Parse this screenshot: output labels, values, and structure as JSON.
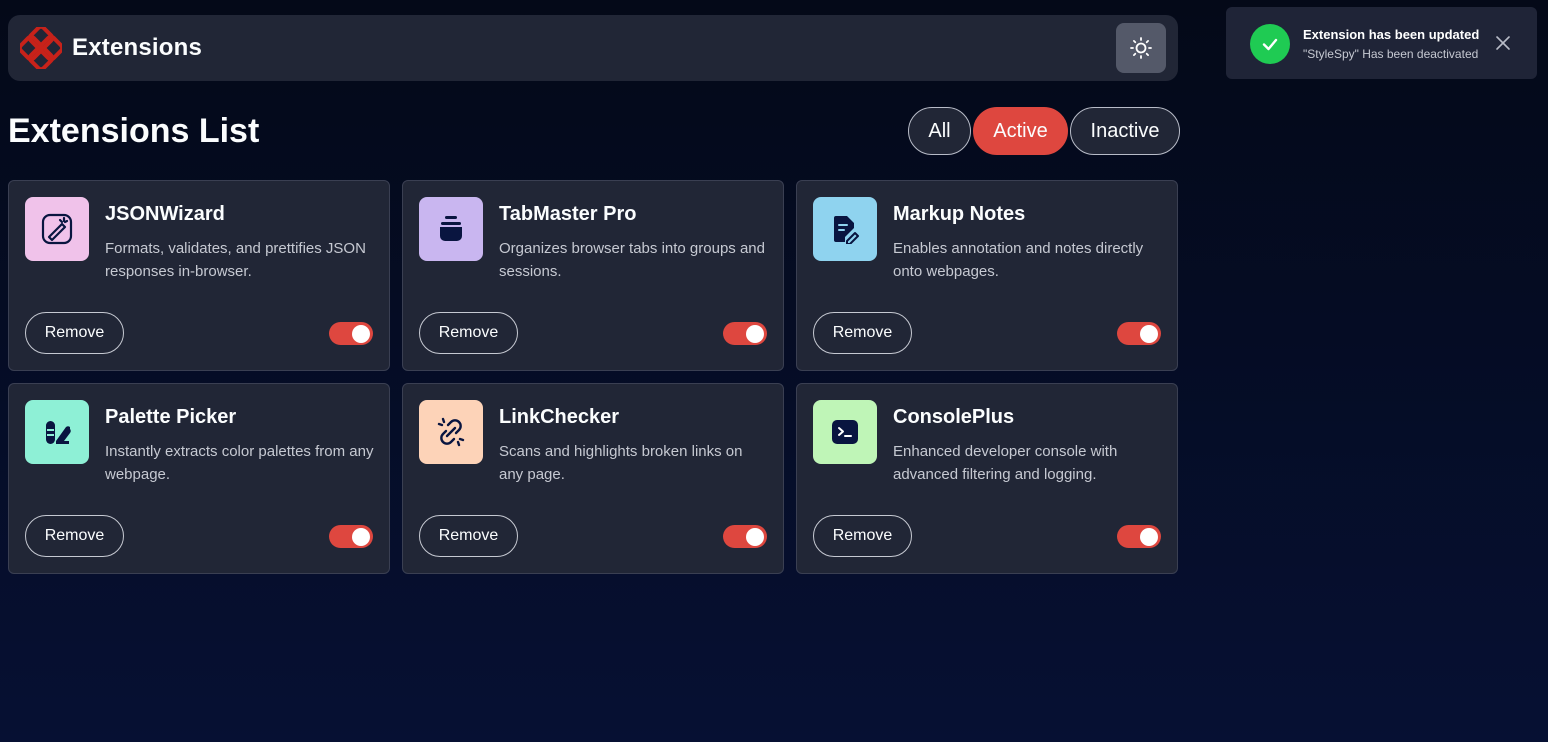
{
  "header": {
    "app_title": "Extensions",
    "logo_icon": "extensions-logo-icon",
    "theme_toggle_icon": "sun-icon"
  },
  "list": {
    "title": "Extensions List",
    "filters": [
      {
        "label": "All",
        "selected": false
      },
      {
        "label": "Active",
        "selected": true
      },
      {
        "label": "Inactive",
        "selected": false
      }
    ]
  },
  "extensions": [
    {
      "name": "JSONWizard",
      "description": "Formats, validates, and prettifies JSON responses in-browser.",
      "remove_label": "Remove",
      "active": true,
      "icon": "json-wizard-icon",
      "icon_bg": "#f0c2ea"
    },
    {
      "name": "TabMaster Pro",
      "description": "Organizes browser tabs into groups and sessions.",
      "remove_label": "Remove",
      "active": true,
      "icon": "tab-master-icon",
      "icon_bg": "#c9b6f0"
    },
    {
      "name": "Markup Notes",
      "description": "Enables annotation and notes directly onto webpages.",
      "remove_label": "Remove",
      "active": true,
      "icon": "markup-notes-icon",
      "icon_bg": "#8fd3ef"
    },
    {
      "name": "Palette Picker",
      "description": "Instantly extracts color palettes from any webpage.",
      "remove_label": "Remove",
      "active": true,
      "icon": "palette-picker-icon",
      "icon_bg": "#8ef0d6"
    },
    {
      "name": "LinkChecker",
      "description": "Scans and highlights broken links on any page.",
      "remove_label": "Remove",
      "active": true,
      "icon": "link-checker-icon",
      "icon_bg": "#fdd3b8"
    },
    {
      "name": "ConsolePlus",
      "description": "Enhanced developer console with advanced filtering and logging.",
      "remove_label": "Remove",
      "active": true,
      "icon": "console-plus-icon",
      "icon_bg": "#bff5b7"
    }
  ],
  "toast": {
    "title": "Extension has been updated",
    "message": "\"StyleSpy\" Has been deactivated",
    "icon": "check-icon",
    "close_icon": "close-icon"
  },
  "colors": {
    "accent": "#de473f",
    "success": "#1fcb53",
    "card_bg": "#212636",
    "page_bg": "#040918"
  }
}
